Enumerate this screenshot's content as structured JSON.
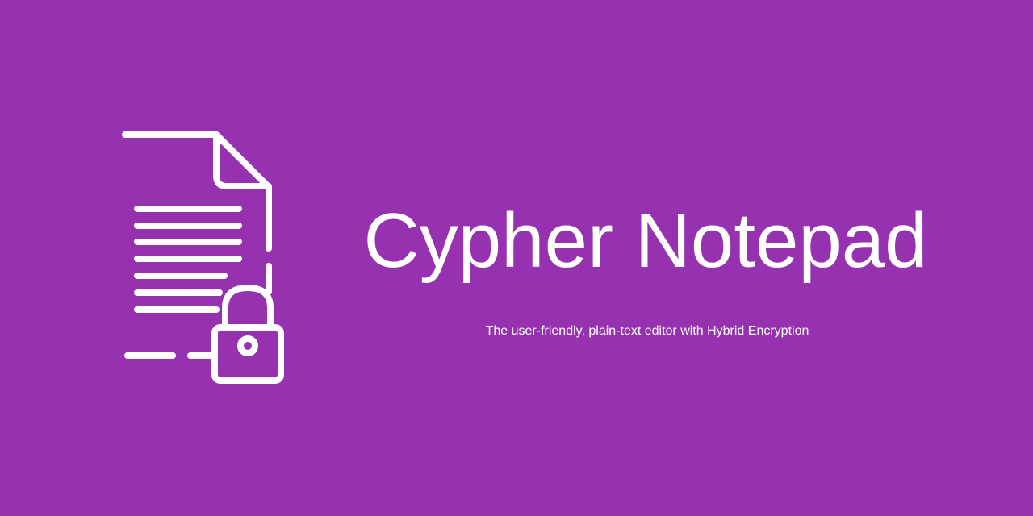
{
  "theme": {
    "background": "#9632b0",
    "foreground": "#ffffff"
  },
  "logo": {
    "icon": "encrypted-document-icon"
  },
  "header": {
    "title": "Cypher Notepad",
    "tagline": "The user-friendly, plain-text editor with Hybrid Encryption"
  }
}
